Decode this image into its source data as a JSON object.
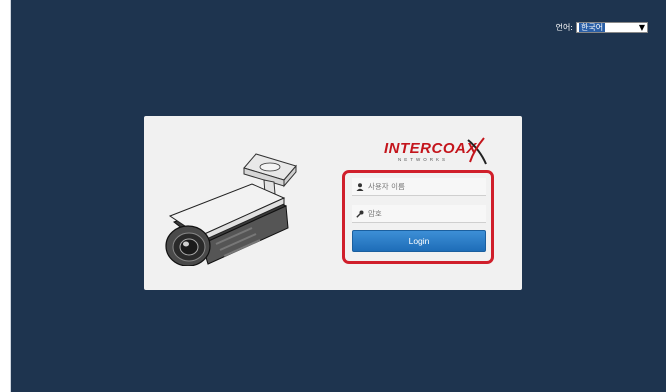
{
  "header": {
    "language_label": "언어:",
    "language_value": "한국어"
  },
  "logo": {
    "brand": "INTERCOAX",
    "sub": "NETWORKS"
  },
  "form": {
    "username_placeholder": "사용자 이름",
    "password_placeholder": "암호",
    "login_label": "Login"
  },
  "colors": {
    "background": "#1e344f",
    "panel": "#f1f1f1",
    "login_button": "#2a7cc7",
    "highlight": "#d01f2b",
    "logo": "#c4151c"
  },
  "icons": [
    "user-icon",
    "key-icon",
    "chevron-down-icon",
    "camera-image"
  ]
}
